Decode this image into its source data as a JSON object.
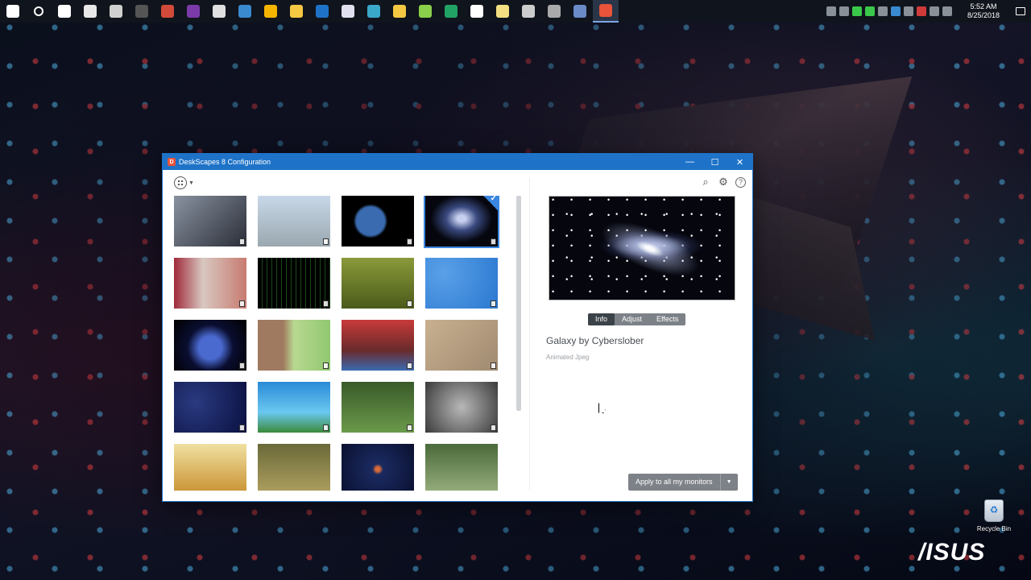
{
  "taskbar": {
    "apps": [
      {
        "name": "windows-start",
        "color": "#ffffff"
      },
      {
        "name": "cortana",
        "color": "#ffffff"
      },
      {
        "name": "task-view",
        "color": "#ffffff"
      },
      {
        "name": "film-app",
        "color": "#e8e8e8"
      },
      {
        "name": "store",
        "color": "#d0d0d0"
      },
      {
        "name": "app-dark",
        "color": "#555555"
      },
      {
        "name": "app-car",
        "color": "#d24a3a"
      },
      {
        "name": "app-circle",
        "color": "#7a3aa8"
      },
      {
        "name": "app-sticky",
        "color": "#e0e0e0"
      },
      {
        "name": "app-monitor",
        "color": "#3a8ad0"
      },
      {
        "name": "chrome",
        "color": "#f4b400"
      },
      {
        "name": "file-explorer",
        "color": "#f4c842"
      },
      {
        "name": "edge",
        "color": "#1e73c8"
      },
      {
        "name": "itunes",
        "color": "#e0e0f0"
      },
      {
        "name": "app-diamond",
        "color": "#3aa8c8"
      },
      {
        "name": "app-smile",
        "color": "#f4c842"
      },
      {
        "name": "app-pen",
        "color": "#8ad04a"
      },
      {
        "name": "excel-like",
        "color": "#21a366"
      },
      {
        "name": "app-z",
        "color": "#ffffff"
      },
      {
        "name": "app-notes",
        "color": "#f4e082"
      },
      {
        "name": "app-gear",
        "color": "#cccccc"
      },
      {
        "name": "app-bar",
        "color": "#aaaaaa"
      },
      {
        "name": "app-ring",
        "color": "#6a8ac8"
      },
      {
        "name": "deskscapes",
        "color": "#e8533a",
        "active": true
      }
    ],
    "clock": {
      "time": "5:52 AM",
      "date": "8/25/2018"
    }
  },
  "window": {
    "title": "DeskScapes 8 Configuration",
    "controls": {
      "minimize": "—",
      "maximize": "☐",
      "close": "✕"
    }
  },
  "gallery": {
    "thumbnails": [
      {
        "name": "cyborg",
        "bg": "linear-gradient(135deg,#8a92a0,#2a2e38)"
      },
      {
        "name": "arctic-base",
        "bg": "linear-gradient(#c8d8e8,#9aa8b0)"
      },
      {
        "name": "earth",
        "bg": "radial-gradient(circle at 40% 50%,#3a6ab0 0 28%,#000 34%)"
      },
      {
        "name": "galaxy",
        "bg": "radial-gradient(ellipse at 50% 45%,#c8d0f0 0 8%,#3a4a80 30%,#05060e 60%)",
        "selected": true
      },
      {
        "name": "robot-face",
        "bg": "linear-gradient(90deg,#a02a3a,#d8c8c0 40%,#c87a70)"
      },
      {
        "name": "matrix-code",
        "bg": "repeating-linear-gradient(90deg,#000 0 5px,#1a4a1a 5px 6px)"
      },
      {
        "name": "grass-field",
        "bg": "linear-gradient(#8a9a3a,#4a5a1a)"
      },
      {
        "name": "blue-ripple",
        "bg": "radial-gradient(circle at 25% 30%,#5aa0e8,#2a78d0)"
      },
      {
        "name": "blue-globe",
        "bg": "radial-gradient(circle at 50% 55%,#4a6ad0 0 25%,#0a0e30 50%,#000)"
      },
      {
        "name": "tree-bark",
        "bg": "linear-gradient(90deg,#a07a60 0 35%,#b8d890 50%,#90c870)"
      },
      {
        "name": "red-car",
        "bg": "linear-gradient(#c83a3a,#6a2a2a 60%,#3a6ab0)"
      },
      {
        "name": "sand-ripple",
        "bg": "linear-gradient(135deg,#c8b090,#a08a70)"
      },
      {
        "name": "snow-night",
        "bg": "radial-gradient(circle at 30% 40%,#2a3a80,#0a1040)"
      },
      {
        "name": "floating-island",
        "bg": "linear-gradient(#2a8ad8,#6ac8f0 60%,#3a8a3a)"
      },
      {
        "name": "golf-ball",
        "bg": "linear-gradient(#3a5a2a,#6a9a4a)"
      },
      {
        "name": "cats",
        "bg": "radial-gradient(circle at 50% 50%,#b8b8b8,#3a3a3a)"
      },
      {
        "name": "wheat",
        "bg": "linear-gradient(#f0e0a0,#c89030)"
      },
      {
        "name": "hay-nest",
        "bg": "linear-gradient(#6a6a3a,#b0a060)"
      },
      {
        "name": "planet-night",
        "bg": "radial-gradient(circle at 50% 50%,#d86a3a 0 5%,#1a2a60 12%,#0a1030)"
      },
      {
        "name": "tree-road",
        "bg": "linear-gradient(#4a6a3a,#9ab080)"
      }
    ]
  },
  "preview": {
    "tabs": [
      "Info",
      "Adjust",
      "Effects"
    ],
    "active_tab": "Info",
    "title": "Galaxy by Cyberslober",
    "subtitle": "Animated Jpeg",
    "apply_label": "Apply to all my monitors"
  },
  "desktop": {
    "recycle_label": "Recycle Bin",
    "brand": "/ISUS"
  }
}
